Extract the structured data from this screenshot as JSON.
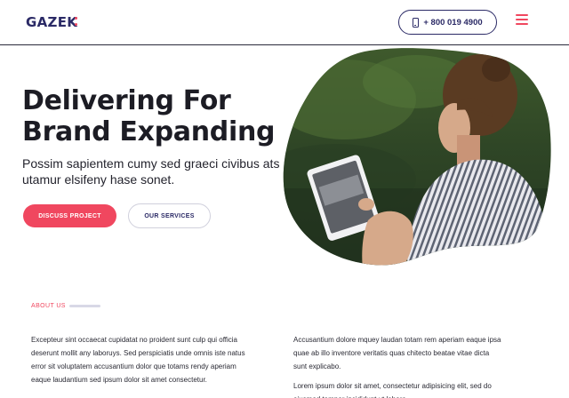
{
  "header": {
    "logo": "GAZEK",
    "phone": "+ 800 019 4900",
    "icons": {
      "phone": "phone-icon",
      "menu": "hamburger-menu-icon"
    }
  },
  "hero": {
    "title_line1": "Delivering For",
    "title_line2": "Brand Expanding",
    "subtitle": "Possim sapientem cumy sed graeci civibus ats utamur elsifeny hase sonet.",
    "primary_button": "DISCUSS PROJECT",
    "secondary_button": "OUR SERVICES",
    "image": "woman-using-tablet-photo"
  },
  "about": {
    "label": "ABOUT US",
    "left_paragraph": "Excepteur sint occaecat cupidatat no proident sunt culp qui officia deserunt mollit any laboruys. Sed perspiciatis unde omnis iste natus error sit voluptatem accusantium dolor que totams rendy aperiam eaque laudantium sed ipsum dolor sit amet consectetur.",
    "right_paragraph_1": "Accusantium dolore mquey laudan totam rem aperiam eaque ipsa quae ab illo inventore veritatis quas chitecto beatae vitae dicta sunt explicabo.",
    "right_paragraph_2": "Lorem ipsum dolor sit amet, consectetur adipisicing elit, sed do eiusmod tempor incididunt ut labore."
  },
  "colors": {
    "accent": "#f0475f",
    "brand": "#2b2a66",
    "text": "#1c1c24"
  }
}
